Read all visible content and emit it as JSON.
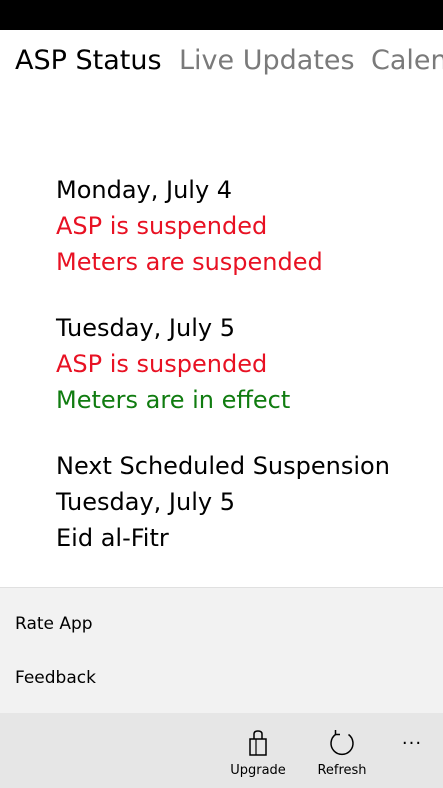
{
  "pivot": {
    "tabs": [
      {
        "label": "ASP Status",
        "active": true
      },
      {
        "label": "Live Updates",
        "active": false
      },
      {
        "label": "Calen",
        "active": false
      }
    ]
  },
  "days": [
    {
      "date": "Monday, July 4",
      "asp": "ASP is suspended",
      "meters": "Meters are suspended"
    },
    {
      "date": "Tuesday, July 5",
      "asp": "ASP is suspended",
      "meters": "Meters are in effect"
    }
  ],
  "next": {
    "heading": "Next Scheduled Suspension",
    "date": "Tuesday, July 5",
    "holiday": "Eid al-Fitr"
  },
  "menu": {
    "rate_label": "Rate App",
    "feedback_label": "Feedback"
  },
  "app_bar": {
    "upgrade_label": "Upgrade",
    "refresh_label": "Refresh",
    "more_label": "..."
  },
  "colors": {
    "suspended": "#e81123",
    "in_effect": "#107c10",
    "app_bar_bg": "#e6e6e6",
    "menu_bg": "#f2f2f2"
  }
}
